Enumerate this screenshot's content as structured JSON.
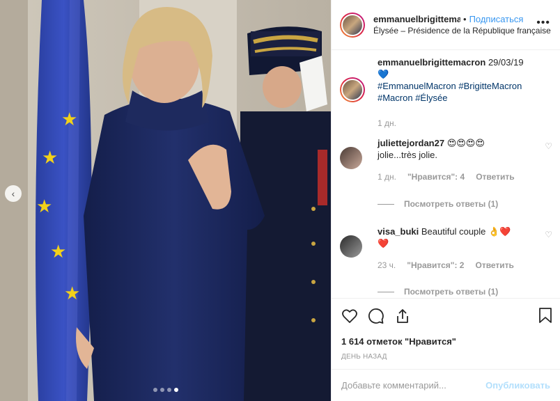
{
  "header": {
    "username": "emmanuelbrigittemacron",
    "separator": "•",
    "follow": "Подписаться",
    "location": "Élysée – Présidence de la République française"
  },
  "caption": {
    "username": "emmanuelbrigittemacron",
    "date_text": "29/03/19",
    "emoji": "💙",
    "hashtags": [
      "#EmmanuelMacron",
      "#BrigitteMacron",
      "#Macron",
      "#Élysée"
    ],
    "age": "1 дн."
  },
  "comments": [
    {
      "username": "juliettejordan27",
      "text_emoji": "😍😍😍😍",
      "text": "jolie...très jolie.",
      "age": "1 дн.",
      "likes": "\"Нравится\": 4",
      "reply": "Ответить",
      "view_replies": "Посмотреть ответы (1)"
    },
    {
      "username": "visa_buki",
      "text": "Beautiful couple",
      "text_emoji": "👌❤️",
      "text_emoji2": "❤️",
      "age": "23 ч.",
      "likes": "\"Нравится\": 2",
      "reply": "Ответить",
      "view_replies": "Посмотреть ответы (1)"
    }
  ],
  "actions": {
    "likes": "1 614 отметок \"Нравится\"",
    "time_ago": "ДЕНЬ НАЗАД"
  },
  "add_comment": {
    "placeholder": "Добавьте комментарий...",
    "post": "Опубликовать"
  },
  "carousel": {
    "slides": 4,
    "active": 4
  },
  "icons": [
    "more-icon",
    "heart-icon",
    "comment-icon",
    "share-icon",
    "bookmark-icon",
    "chevron-left-icon"
  ],
  "colors": {
    "link": "#3897f0",
    "hashtag": "#003569",
    "muted": "#999999"
  }
}
